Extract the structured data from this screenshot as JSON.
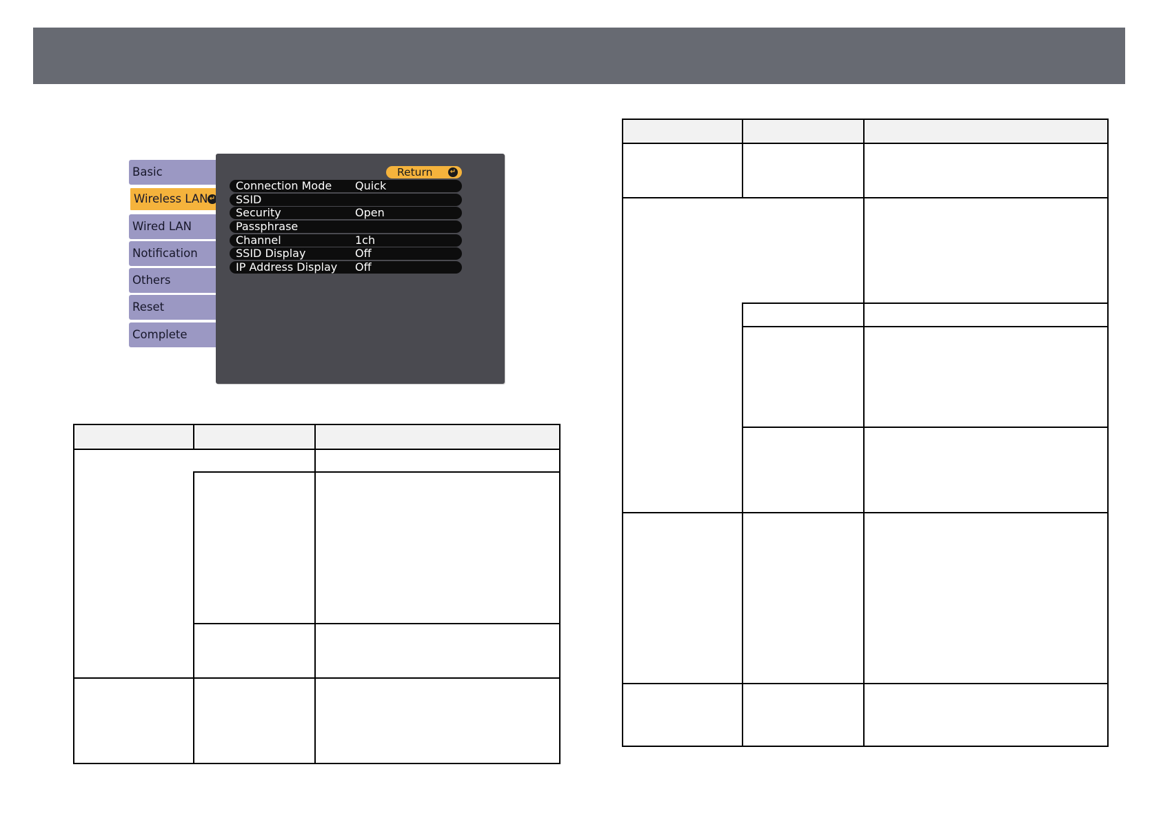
{
  "osd": {
    "tabs": [
      {
        "label": "Basic",
        "active": false
      },
      {
        "label": "Wireless LAN",
        "active": true
      },
      {
        "label": "Wired LAN",
        "active": false
      },
      {
        "label": "Notification",
        "active": false
      },
      {
        "label": "Others",
        "active": false
      },
      {
        "label": "Reset",
        "active": false
      },
      {
        "label": "Complete",
        "active": false
      }
    ],
    "return_label": "Return",
    "settings": [
      {
        "label": "Connection Mode",
        "value": "Quick"
      },
      {
        "label": "SSID",
        "value": ""
      },
      {
        "label": "Security",
        "value": "Open"
      },
      {
        "label": "Passphrase",
        "value": ""
      },
      {
        "label": "Channel",
        "value": "1ch"
      },
      {
        "label": "SSID Display",
        "value": "Off"
      },
      {
        "label": "IP Address Display",
        "value": "Off"
      }
    ]
  },
  "colors": {
    "header_bar": "#676a72",
    "tab_inactive": "#9b98c3",
    "tab_active": "#f5b33c",
    "panel": "#4a4a50",
    "row": "#0d0d0d"
  }
}
